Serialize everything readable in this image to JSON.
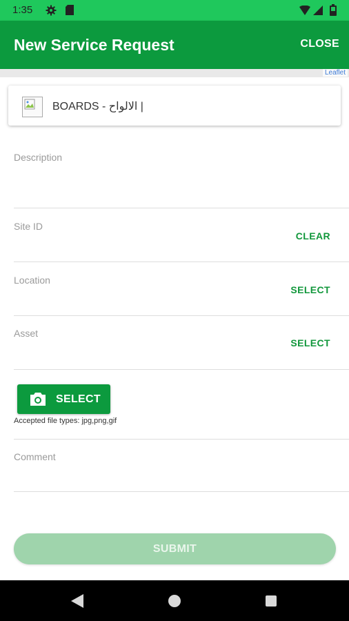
{
  "status_bar": {
    "time": "1:35",
    "icons": [
      "gear-icon",
      "sd-card-icon",
      "wifi-icon",
      "signal-icon",
      "battery-icon"
    ]
  },
  "app_bar": {
    "title": "New Service Request",
    "close_label": "CLOSE"
  },
  "map": {
    "attribution": "Leaflet"
  },
  "category": {
    "label": "BOARDS - الالواح |"
  },
  "form": {
    "description_label": "Description",
    "site_id_label": "Site ID",
    "site_id_action": "CLEAR",
    "location_label": "Location",
    "location_action": "SELECT",
    "asset_label": "Asset",
    "asset_action": "SELECT",
    "photo_button_label": "SELECT",
    "accepted_types": "Accepted file types: jpg,png,gif",
    "comment_label": "Comment",
    "submit_label": "SUBMIT"
  },
  "colors": {
    "status_bar": "#1fc85c",
    "app_bar": "#0c9a3e",
    "accent": "#11973b",
    "submit_disabled": "#9fd4ac"
  }
}
